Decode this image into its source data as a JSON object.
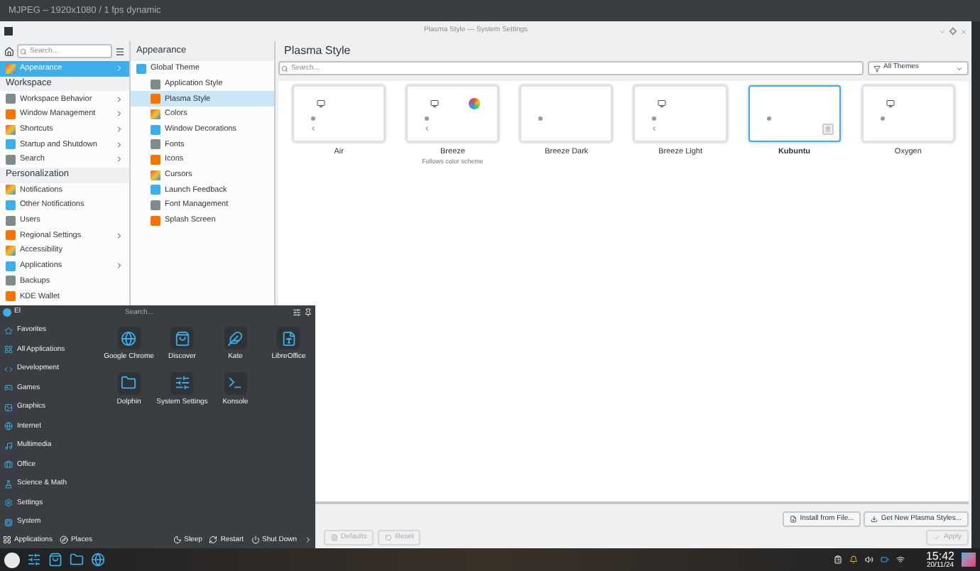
{
  "top_bar": {
    "title": "MJPEG – 1920x1080 / 1 fps dynamic"
  },
  "window": {
    "title": "Plasma Style — System Settings"
  },
  "sidebar": {
    "search": {
      "placeholder": "Search..."
    },
    "items": [
      {
        "kind": "item",
        "label": "Appearance",
        "selected": true,
        "has_children": true
      },
      {
        "kind": "header",
        "label": "Workspace"
      },
      {
        "kind": "item",
        "label": "Workspace Behavior",
        "selected": false,
        "has_children": true
      },
      {
        "kind": "item",
        "label": "Window Management",
        "selected": false,
        "has_children": true
      },
      {
        "kind": "item",
        "label": "Shortcuts",
        "selected": false,
        "has_children": true
      },
      {
        "kind": "item",
        "label": "Startup and Shutdown",
        "selected": false,
        "has_children": true
      },
      {
        "kind": "item",
        "label": "Search",
        "selected": false,
        "has_children": true
      },
      {
        "kind": "header",
        "label": "Personalization"
      },
      {
        "kind": "item",
        "label": "Notifications",
        "selected": false,
        "has_children": false
      },
      {
        "kind": "item",
        "label": "Other Notifications",
        "selected": false,
        "has_children": false
      },
      {
        "kind": "item",
        "label": "Users",
        "selected": false,
        "has_children": false
      },
      {
        "kind": "item",
        "label": "Regional Settings",
        "selected": false,
        "has_children": true
      },
      {
        "kind": "item",
        "label": "Accessibility",
        "selected": false,
        "has_children": false
      },
      {
        "kind": "item",
        "label": "Applications",
        "selected": false,
        "has_children": true
      },
      {
        "kind": "item",
        "label": "Backups",
        "selected": false,
        "has_children": false
      },
      {
        "kind": "item",
        "label": "KDE Wallet",
        "selected": false,
        "has_children": false
      }
    ]
  },
  "category": {
    "title": "Appearance",
    "items": [
      {
        "label": "Global Theme",
        "selected": false
      },
      {
        "label": "Application Style",
        "selected": false
      },
      {
        "label": "Plasma Style",
        "selected": true
      },
      {
        "label": "Colors",
        "selected": false
      },
      {
        "label": "Window Decorations",
        "selected": false
      },
      {
        "label": "Fonts",
        "selected": false
      },
      {
        "label": "Icons",
        "selected": false
      },
      {
        "label": "Cursors",
        "selected": false
      },
      {
        "label": "Launch Feedback",
        "selected": false
      },
      {
        "label": "Font Management",
        "selected": false
      },
      {
        "label": "Splash Screen",
        "selected": false
      }
    ]
  },
  "page": {
    "title": "Plasma Style",
    "search": {
      "placeholder": "Search..."
    },
    "filter": {
      "label": "All Themes"
    },
    "themes": [
      {
        "name": "Air",
        "selected": false,
        "monitor": true,
        "back_arrow": true,
        "color_wheel": false,
        "removable": false
      },
      {
        "name": "Breeze",
        "subtitle": "Follows color scheme",
        "selected": false,
        "monitor": true,
        "back_arrow": true,
        "color_wheel": true,
        "removable": false
      },
      {
        "name": "Breeze Dark",
        "selected": false,
        "monitor": false,
        "back_arrow": false,
        "color_wheel": false,
        "removable": false
      },
      {
        "name": "Breeze Light",
        "selected": false,
        "monitor": true,
        "back_arrow": true,
        "color_wheel": false,
        "removable": false
      },
      {
        "name": "Kubuntu",
        "selected": true,
        "monitor": false,
        "back_arrow": false,
        "color_wheel": false,
        "removable": true
      },
      {
        "name": "Oxygen",
        "selected": false,
        "monitor": true,
        "back_arrow": false,
        "color_wheel": false,
        "removable": false
      }
    ],
    "actions": [
      "Install from File...",
      "Get New Plasma Styles..."
    ],
    "footer": [
      {
        "kind": "defaults",
        "label": "Defaults",
        "disabled": true
      },
      {
        "kind": "reset",
        "label": "Reset",
        "disabled": true
      },
      {
        "kind": "apply",
        "label": "Apply",
        "disabled": true
      }
    ]
  },
  "launcher": {
    "user": "El",
    "search": {
      "placeholder": "Search..."
    },
    "categories": [
      "Favorites",
      "All Applications",
      "Development",
      "Games",
      "Graphics",
      "Internet",
      "Multimedia",
      "Office",
      "Science & Math",
      "Settings",
      "System"
    ],
    "apps": [
      "Google Chrome",
      "Discover",
      "Kate",
      "LibreOffice",
      "Dolphin",
      "System Settings",
      "Konsole"
    ],
    "tabs": [
      "Applications",
      "Places"
    ],
    "power": [
      "Sleep",
      "Restart",
      "Shut Down"
    ]
  },
  "taskbar": {
    "time": "15:42",
    "date": "20/11/24"
  }
}
